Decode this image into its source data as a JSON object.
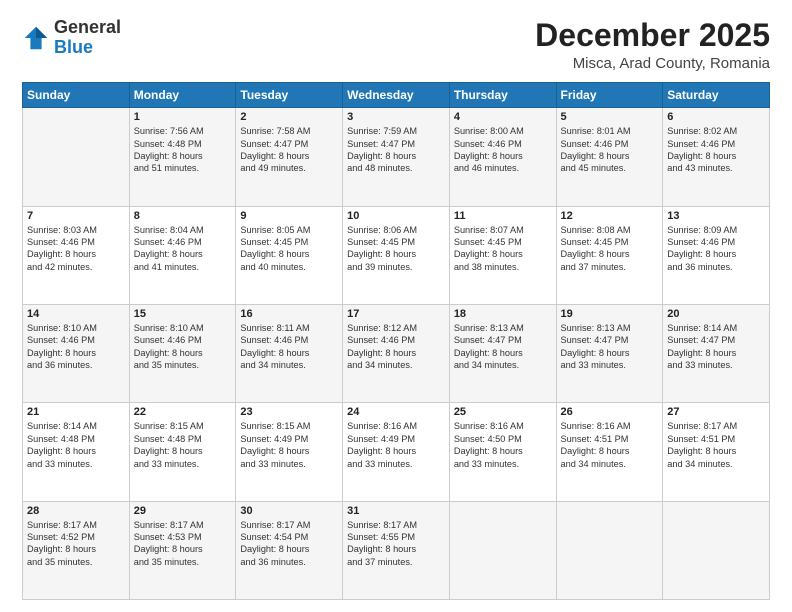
{
  "logo": {
    "general": "General",
    "blue": "Blue"
  },
  "header": {
    "month": "December 2025",
    "location": "Misca, Arad County, Romania"
  },
  "days": [
    "Sunday",
    "Monday",
    "Tuesday",
    "Wednesday",
    "Thursday",
    "Friday",
    "Saturday"
  ],
  "weeks": [
    [
      {
        "num": "",
        "lines": []
      },
      {
        "num": "1",
        "lines": [
          "Sunrise: 7:56 AM",
          "Sunset: 4:48 PM",
          "Daylight: 8 hours",
          "and 51 minutes."
        ]
      },
      {
        "num": "2",
        "lines": [
          "Sunrise: 7:58 AM",
          "Sunset: 4:47 PM",
          "Daylight: 8 hours",
          "and 49 minutes."
        ]
      },
      {
        "num": "3",
        "lines": [
          "Sunrise: 7:59 AM",
          "Sunset: 4:47 PM",
          "Daylight: 8 hours",
          "and 48 minutes."
        ]
      },
      {
        "num": "4",
        "lines": [
          "Sunrise: 8:00 AM",
          "Sunset: 4:46 PM",
          "Daylight: 8 hours",
          "and 46 minutes."
        ]
      },
      {
        "num": "5",
        "lines": [
          "Sunrise: 8:01 AM",
          "Sunset: 4:46 PM",
          "Daylight: 8 hours",
          "and 45 minutes."
        ]
      },
      {
        "num": "6",
        "lines": [
          "Sunrise: 8:02 AM",
          "Sunset: 4:46 PM",
          "Daylight: 8 hours",
          "and 43 minutes."
        ]
      }
    ],
    [
      {
        "num": "7",
        "lines": [
          "Sunrise: 8:03 AM",
          "Sunset: 4:46 PM",
          "Daylight: 8 hours",
          "and 42 minutes."
        ]
      },
      {
        "num": "8",
        "lines": [
          "Sunrise: 8:04 AM",
          "Sunset: 4:46 PM",
          "Daylight: 8 hours",
          "and 41 minutes."
        ]
      },
      {
        "num": "9",
        "lines": [
          "Sunrise: 8:05 AM",
          "Sunset: 4:45 PM",
          "Daylight: 8 hours",
          "and 40 minutes."
        ]
      },
      {
        "num": "10",
        "lines": [
          "Sunrise: 8:06 AM",
          "Sunset: 4:45 PM",
          "Daylight: 8 hours",
          "and 39 minutes."
        ]
      },
      {
        "num": "11",
        "lines": [
          "Sunrise: 8:07 AM",
          "Sunset: 4:45 PM",
          "Daylight: 8 hours",
          "and 38 minutes."
        ]
      },
      {
        "num": "12",
        "lines": [
          "Sunrise: 8:08 AM",
          "Sunset: 4:45 PM",
          "Daylight: 8 hours",
          "and 37 minutes."
        ]
      },
      {
        "num": "13",
        "lines": [
          "Sunrise: 8:09 AM",
          "Sunset: 4:46 PM",
          "Daylight: 8 hours",
          "and 36 minutes."
        ]
      }
    ],
    [
      {
        "num": "14",
        "lines": [
          "Sunrise: 8:10 AM",
          "Sunset: 4:46 PM",
          "Daylight: 8 hours",
          "and 36 minutes."
        ]
      },
      {
        "num": "15",
        "lines": [
          "Sunrise: 8:10 AM",
          "Sunset: 4:46 PM",
          "Daylight: 8 hours",
          "and 35 minutes."
        ]
      },
      {
        "num": "16",
        "lines": [
          "Sunrise: 8:11 AM",
          "Sunset: 4:46 PM",
          "Daylight: 8 hours",
          "and 34 minutes."
        ]
      },
      {
        "num": "17",
        "lines": [
          "Sunrise: 8:12 AM",
          "Sunset: 4:46 PM",
          "Daylight: 8 hours",
          "and 34 minutes."
        ]
      },
      {
        "num": "18",
        "lines": [
          "Sunrise: 8:13 AM",
          "Sunset: 4:47 PM",
          "Daylight: 8 hours",
          "and 34 minutes."
        ]
      },
      {
        "num": "19",
        "lines": [
          "Sunrise: 8:13 AM",
          "Sunset: 4:47 PM",
          "Daylight: 8 hours",
          "and 33 minutes."
        ]
      },
      {
        "num": "20",
        "lines": [
          "Sunrise: 8:14 AM",
          "Sunset: 4:47 PM",
          "Daylight: 8 hours",
          "and 33 minutes."
        ]
      }
    ],
    [
      {
        "num": "21",
        "lines": [
          "Sunrise: 8:14 AM",
          "Sunset: 4:48 PM",
          "Daylight: 8 hours",
          "and 33 minutes."
        ]
      },
      {
        "num": "22",
        "lines": [
          "Sunrise: 8:15 AM",
          "Sunset: 4:48 PM",
          "Daylight: 8 hours",
          "and 33 minutes."
        ]
      },
      {
        "num": "23",
        "lines": [
          "Sunrise: 8:15 AM",
          "Sunset: 4:49 PM",
          "Daylight: 8 hours",
          "and 33 minutes."
        ]
      },
      {
        "num": "24",
        "lines": [
          "Sunrise: 8:16 AM",
          "Sunset: 4:49 PM",
          "Daylight: 8 hours",
          "and 33 minutes."
        ]
      },
      {
        "num": "25",
        "lines": [
          "Sunrise: 8:16 AM",
          "Sunset: 4:50 PM",
          "Daylight: 8 hours",
          "and 33 minutes."
        ]
      },
      {
        "num": "26",
        "lines": [
          "Sunrise: 8:16 AM",
          "Sunset: 4:51 PM",
          "Daylight: 8 hours",
          "and 34 minutes."
        ]
      },
      {
        "num": "27",
        "lines": [
          "Sunrise: 8:17 AM",
          "Sunset: 4:51 PM",
          "Daylight: 8 hours",
          "and 34 minutes."
        ]
      }
    ],
    [
      {
        "num": "28",
        "lines": [
          "Sunrise: 8:17 AM",
          "Sunset: 4:52 PM",
          "Daylight: 8 hours",
          "and 35 minutes."
        ]
      },
      {
        "num": "29",
        "lines": [
          "Sunrise: 8:17 AM",
          "Sunset: 4:53 PM",
          "Daylight: 8 hours",
          "and 35 minutes."
        ]
      },
      {
        "num": "30",
        "lines": [
          "Sunrise: 8:17 AM",
          "Sunset: 4:54 PM",
          "Daylight: 8 hours",
          "and 36 minutes."
        ]
      },
      {
        "num": "31",
        "lines": [
          "Sunrise: 8:17 AM",
          "Sunset: 4:55 PM",
          "Daylight: 8 hours",
          "and 37 minutes."
        ]
      },
      {
        "num": "",
        "lines": []
      },
      {
        "num": "",
        "lines": []
      },
      {
        "num": "",
        "lines": []
      }
    ]
  ]
}
